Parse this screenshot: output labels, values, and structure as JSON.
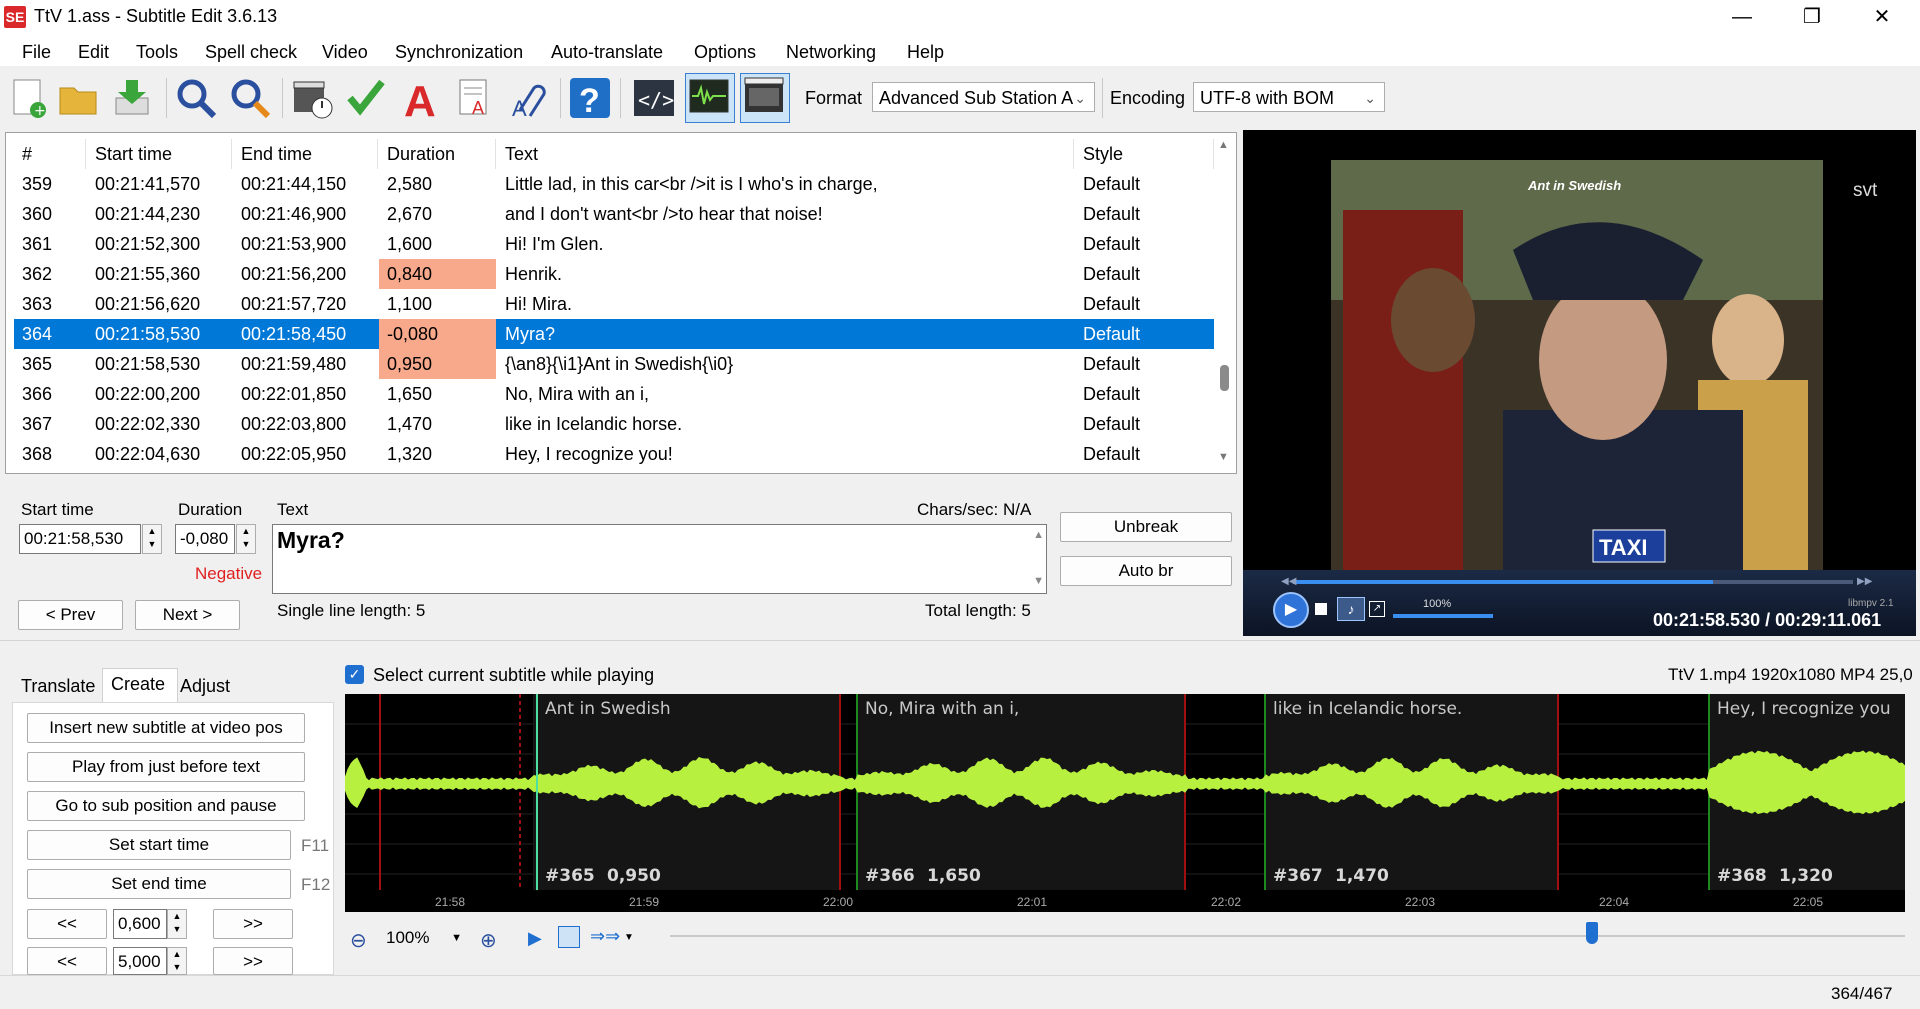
{
  "window": {
    "title": "TtV 1.ass - Subtitle Edit 3.6.13",
    "logo": "SE"
  },
  "menu": [
    "File",
    "Edit",
    "Tools",
    "Spell check",
    "Video",
    "Synchronization",
    "Auto-translate",
    "Options",
    "Networking",
    "Help"
  ],
  "toolbar": {
    "format_label": "Format",
    "format_value": "Advanced Sub Station A",
    "encoding_label": "Encoding",
    "encoding_value": "UTF-8 with BOM"
  },
  "grid": {
    "columns": [
      "#",
      "Start time",
      "End time",
      "Duration",
      "Text",
      "Style"
    ],
    "rows": [
      {
        "num": "359",
        "start": "00:21:41,570",
        "end": "00:21:44,150",
        "dur": "2,580",
        "text": "Little lad, in this car<br />it is I who's in charge,",
        "style": "Default",
        "warn": false
      },
      {
        "num": "360",
        "start": "00:21:44,230",
        "end": "00:21:46,900",
        "dur": "2,670",
        "text": "and I don't want<br />to hear that noise!",
        "style": "Default",
        "warn": false
      },
      {
        "num": "361",
        "start": "00:21:52,300",
        "end": "00:21:53,900",
        "dur": "1,600",
        "text": "Hi! I'm Glen.",
        "style": "Default",
        "warn": false
      },
      {
        "num": "362",
        "start": "00:21:55,360",
        "end": "00:21:56,200",
        "dur": "0,840",
        "text": "Henrik.",
        "style": "Default",
        "warn": true
      },
      {
        "num": "363",
        "start": "00:21:56,620",
        "end": "00:21:57,720",
        "dur": "1,100",
        "text": "Hi! Mira.",
        "style": "Default",
        "warn": false
      },
      {
        "num": "364",
        "start": "00:21:58,530",
        "end": "00:21:58,450",
        "dur": "-0,080",
        "text": "Myra?",
        "style": "Default",
        "warn": true,
        "selected": true
      },
      {
        "num": "365",
        "start": "00:21:58,530",
        "end": "00:21:59,480",
        "dur": "0,950",
        "text": "{\\an8}{\\i1}Ant in Swedish{\\i0}",
        "style": "Default",
        "warn": true
      },
      {
        "num": "366",
        "start": "00:22:00,200",
        "end": "00:22:01,850",
        "dur": "1,650",
        "text": "No, Mira with an i,",
        "style": "Default",
        "warn": false
      },
      {
        "num": "367",
        "start": "00:22:02,330",
        "end": "00:22:03,800",
        "dur": "1,470",
        "text": "like in Icelandic horse.",
        "style": "Default",
        "warn": false
      },
      {
        "num": "368",
        "start": "00:22:04,630",
        "end": "00:22:05,950",
        "dur": "1,320",
        "text": "Hey, I recognize you!",
        "style": "Default",
        "warn": false
      }
    ]
  },
  "video": {
    "overlay_title": "Ant in Swedish",
    "channel": "svt",
    "taxi_sign": "TAXI",
    "volume": "100%",
    "engine": "libmpv 2.1",
    "time": "00:21:58.530 / 00:29:11.061",
    "progress": 0.75,
    "volume_level": 1.0
  },
  "edit": {
    "start_label": "Start time",
    "start_value": "00:21:58,530",
    "duration_label": "Duration",
    "duration_value": "-0,080",
    "negative_label": "Negative",
    "text_label": "Text",
    "chars_sec": "Chars/sec: N/A",
    "text_value": "Myra?",
    "single_line": "Single line length: 5",
    "total_length": "Total length: 5",
    "unbreak": "Unbreak",
    "auto_br": "Auto br",
    "prev": "< Prev",
    "next": "Next >"
  },
  "tabs": [
    "Translate",
    "Create",
    "Adjust"
  ],
  "create": {
    "insert": "Insert new subtitle at video pos",
    "play_before": "Play from just before text",
    "goto_pause": "Go to sub position and pause",
    "set_start": "Set start time",
    "set_start_key": "F11",
    "set_end": "Set end time",
    "set_end_key": "F12",
    "back": "<<",
    "fwd": ">>",
    "step1": "0,600",
    "step2": "5,000"
  },
  "waveform": {
    "select_current": "Select current subtitle while playing",
    "file_info": "TtV 1.mp4 1920x1080 MP4 25,0",
    "subs": [
      {
        "text": "Ant in Swedish",
        "num": "#365",
        "dur": "0,950"
      },
      {
        "text": "No, Mira with an i,",
        "num": "#366",
        "dur": "1,650"
      },
      {
        "text": "like in Icelandic horse.",
        "num": "#367",
        "dur": "1,470"
      },
      {
        "text": "Hey, I recognize you",
        "num": "#368",
        "dur": "1,320"
      }
    ],
    "ticks": [
      "21:58",
      "21:59",
      "22:00",
      "22:01",
      "22:02",
      "22:03",
      "22:04",
      "22:05"
    ],
    "zoom": "100%"
  },
  "status": {
    "position": "364/467"
  }
}
